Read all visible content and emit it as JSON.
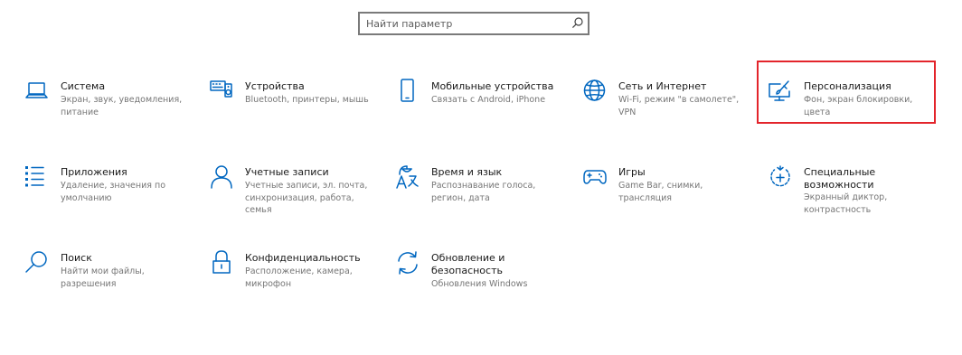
{
  "search": {
    "placeholder": "Найти параметр"
  },
  "tiles": [
    {
      "icon": "laptop-icon",
      "title": "Система",
      "desc": "Экран, звук, уведомления, питание"
    },
    {
      "icon": "keyboard-speaker-icon",
      "title": "Устройства",
      "desc": "Bluetooth, принтеры, мышь"
    },
    {
      "icon": "phone-icon",
      "title": "Мобильные устройства",
      "desc": "Связать с Android, iPhone"
    },
    {
      "icon": "globe-icon",
      "title": "Сеть и Интернет",
      "desc": "Wi-Fi, режим \"в самолете\", VPN"
    },
    {
      "icon": "paintbrush-monitor-icon",
      "title": "Персонализация",
      "desc": "Фон, экран блокировки, цвета"
    },
    {
      "icon": "apps-list-icon",
      "title": "Приложения",
      "desc": "Удаление, значения по умолчанию"
    },
    {
      "icon": "person-icon",
      "title": "Учетные записи",
      "desc": "Учетные записи, эл. почта, синхронизация, работа, семья"
    },
    {
      "icon": "language-time-icon",
      "title": "Время и язык",
      "desc": "Распознавание голоса, регион, дата"
    },
    {
      "icon": "gamepad-icon",
      "title": "Игры",
      "desc": "Game Bar, снимки, трансляция"
    },
    {
      "icon": "accessibility-icon",
      "title": "Специальные возможности",
      "desc": "Экранный диктор, контрастность"
    },
    {
      "icon": "search-icon",
      "title": "Поиск",
      "desc": "Найти мои файлы, разрешения"
    },
    {
      "icon": "lock-icon",
      "title": "Конфиденциальность",
      "desc": "Расположение, камера, микрофон"
    },
    {
      "icon": "update-sync-icon",
      "title": "Обновление и безопасность",
      "desc": "Обновления Windows"
    }
  ]
}
